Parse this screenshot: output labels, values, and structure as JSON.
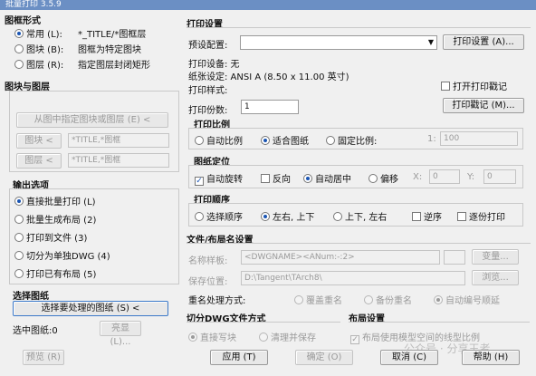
{
  "window": {
    "title": "批量打印 3.5.9"
  },
  "left": {
    "frame_section": "图框形式",
    "frame_options": [
      {
        "label": "常用 (L):",
        "desc": "*_TITLE/*图框层",
        "selected": true
      },
      {
        "label": "图块 (B):",
        "desc": "图框为特定图块",
        "selected": false
      },
      {
        "label": "图层 (R):",
        "desc": "指定图层封闭矩形",
        "selected": false
      }
    ],
    "block_section": "图块与图层",
    "pick_button": "从图中指定图块或图层 (E) <",
    "block_button": "图块 <",
    "block_value": "*TITLE,*图框",
    "layer_button": "图层 <",
    "layer_value": "*TITLE,*图框",
    "output_section": "输出选项",
    "output_options": [
      {
        "label": "直接批量打印 (L)",
        "selected": true
      },
      {
        "label": "批量生成布局 (2)",
        "selected": false
      },
      {
        "label": "打印到文件 (3)",
        "selected": false
      },
      {
        "label": "切分为单独DWG (4)",
        "selected": false
      },
      {
        "label": "打印已有布局 (5)",
        "selected": false
      }
    ],
    "select_section": "选择图纸",
    "select_button": "选择要处理的图纸 (S) <",
    "selected_count_label": "选中图纸:0",
    "highlight_button": "亮显 (L)...",
    "preview_button": "预览 (R)"
  },
  "print": {
    "section": "打印设置",
    "preset_label": "预设配置:",
    "preset_value": "",
    "print_settings_button": "打印设置 (A)...",
    "device_label": "打印设备: 无",
    "paper_label": "纸张设定: ANSI A (8.50 x 11.00 英寸)",
    "style_label": "打印样式:",
    "open_stamp_label": "打开打印戳记",
    "open_stamp_checked": false,
    "copies_label": "打印份数:",
    "copies_value": "1",
    "stamp_button": "打印戳记 (M)...",
    "scale_section": "打印比例",
    "scale_options": [
      {
        "label": "自动比例",
        "selected": false
      },
      {
        "label": "适合图纸",
        "selected": true
      },
      {
        "label": "固定比例:",
        "selected": false
      }
    ],
    "scale_prefix": "1:",
    "scale_value": "100",
    "pos_section": "图纸定位",
    "auto_rotate_label": "自动旋转",
    "auto_rotate_checked": true,
    "reverse_label": "反向",
    "reverse_checked": false,
    "center_label": "自动居中",
    "center_selected": true,
    "offset_label": "偏移",
    "offset_selected": false,
    "x_label": "X:",
    "x_value": "0",
    "y_label": "Y:",
    "y_value": "0",
    "order_section": "打印顺序",
    "order_options": [
      {
        "label": "选择顺序",
        "selected": false
      },
      {
        "label": "左右, 上下",
        "selected": true
      },
      {
        "label": "上下, 左右",
        "selected": false
      }
    ],
    "reverse_order_label": "逆序",
    "reverse_order_checked": false,
    "copy_print_label": "逐份打印",
    "copy_print_checked": false
  },
  "files": {
    "section": "文件/布局名设置",
    "name_label": "名称样板:",
    "name_value": "<DWGNAME><ANum:-:2>",
    "var_button": "变量...",
    "save_label": "保存位置:",
    "save_value": "D:\\Tangent\\TArch8\\",
    "browse_button": "浏览...",
    "rename_label": "重名处理方式:",
    "rename_options": [
      {
        "label": "覆盖重名",
        "selected": false
      },
      {
        "label": "备份重名",
        "selected": false
      },
      {
        "label": "自动编号顺延",
        "selected": true
      }
    ]
  },
  "split": {
    "section": "切分DWG文件方式",
    "options": [
      {
        "label": "直接写块",
        "selected": true
      },
      {
        "label": "清理并保存",
        "selected": false
      }
    ]
  },
  "layout": {
    "section": "布局设置",
    "model_linetype_label": "布局使用模型空间的线型比例",
    "model_linetype_checked": true
  },
  "footer": {
    "apply_button": "应用 (T)",
    "ok_button": "确定 (O)",
    "cancel_button": "取消 (C)",
    "help_button": "帮助 (H)",
    "watermark": "公众号 · 分享王者"
  }
}
